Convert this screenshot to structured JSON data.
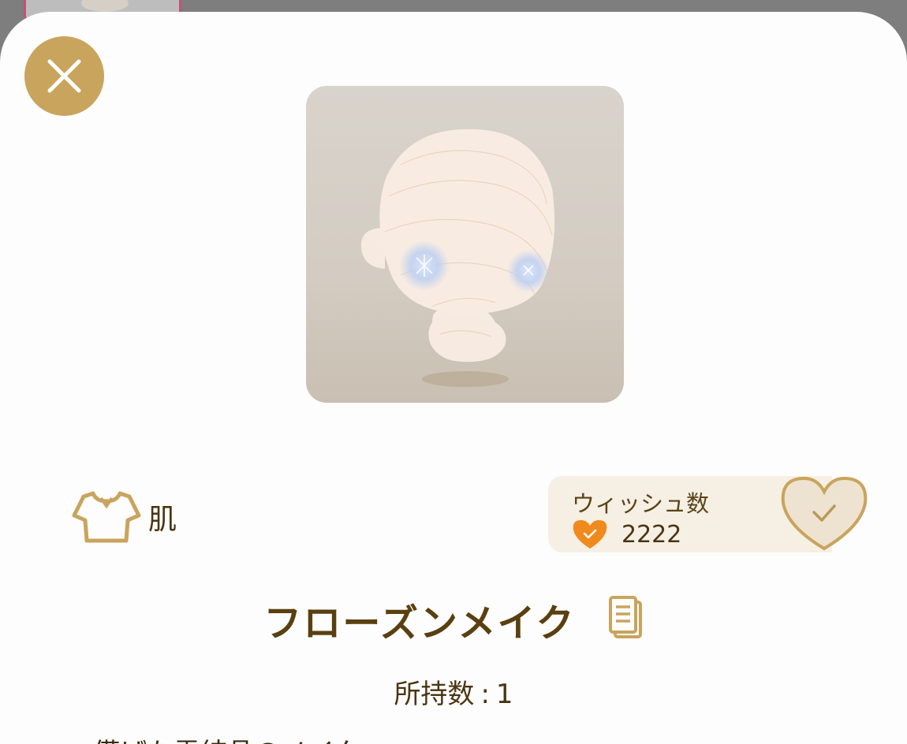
{
  "close_button": {
    "icon": "close-icon",
    "color": "#c9a45d"
  },
  "item": {
    "category_icon": "shirt-icon",
    "category_label": "肌",
    "name": "フローズンメイク",
    "copy_icon": "copy-document-icon",
    "owned_label": "所持数",
    "owned_separator": ":",
    "owned_count": "1",
    "description": "儚げな雪結晶のメイク"
  },
  "wish": {
    "title": "ウィッシュ数",
    "count": "2222",
    "count_icon": "heart-check-icon",
    "button_icon": "heart-check-outline-icon",
    "accent_color": "#f08a1c"
  },
  "colors": {
    "gold": "#c9a45d",
    "text_brown": "#5a4010"
  }
}
